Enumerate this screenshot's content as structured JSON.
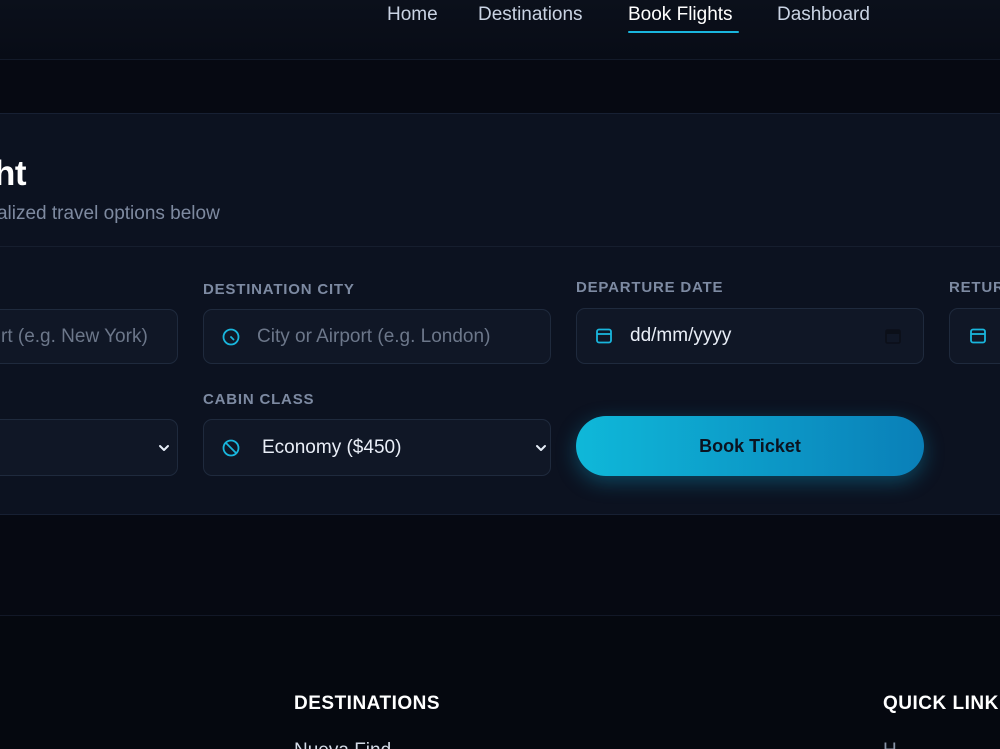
{
  "nav": {
    "links": [
      {
        "label": "Home"
      },
      {
        "label": "Destinations"
      },
      {
        "label": "Book Flights",
        "active": true
      },
      {
        "label": "Dashboard"
      }
    ]
  },
  "booking": {
    "title": "ht",
    "subtitle": "rsonalized travel options below",
    "origin": {
      "placeholder": "rt (e.g. New York)"
    },
    "destination": {
      "label": "DESTINATION CITY",
      "placeholder": "City or Airport (e.g. London)",
      "icon": "globe-icon"
    },
    "departure": {
      "label": "DEPARTURE DATE",
      "value": "dd/mm/yyyy",
      "icon": "calendar-icon"
    },
    "return": {
      "label": "RETUR",
      "icon": "calendar-icon"
    },
    "cabin": {
      "label": "CABIN CLASS",
      "value": "Economy ($450)",
      "icon": "ban-icon"
    },
    "book_button": "Book Ticket"
  },
  "footer": {
    "destinations_heading": "DESTINATIONS",
    "destinations_first": "Nueva Find",
    "quick_links_heading": "QUICK LINK",
    "quick_links_first": "H"
  },
  "colors": {
    "accent": "#19b6dd",
    "button_start": "#0fb8d9",
    "button_end": "#0a7fb8",
    "background": "#060912",
    "card": "#0c1220"
  }
}
